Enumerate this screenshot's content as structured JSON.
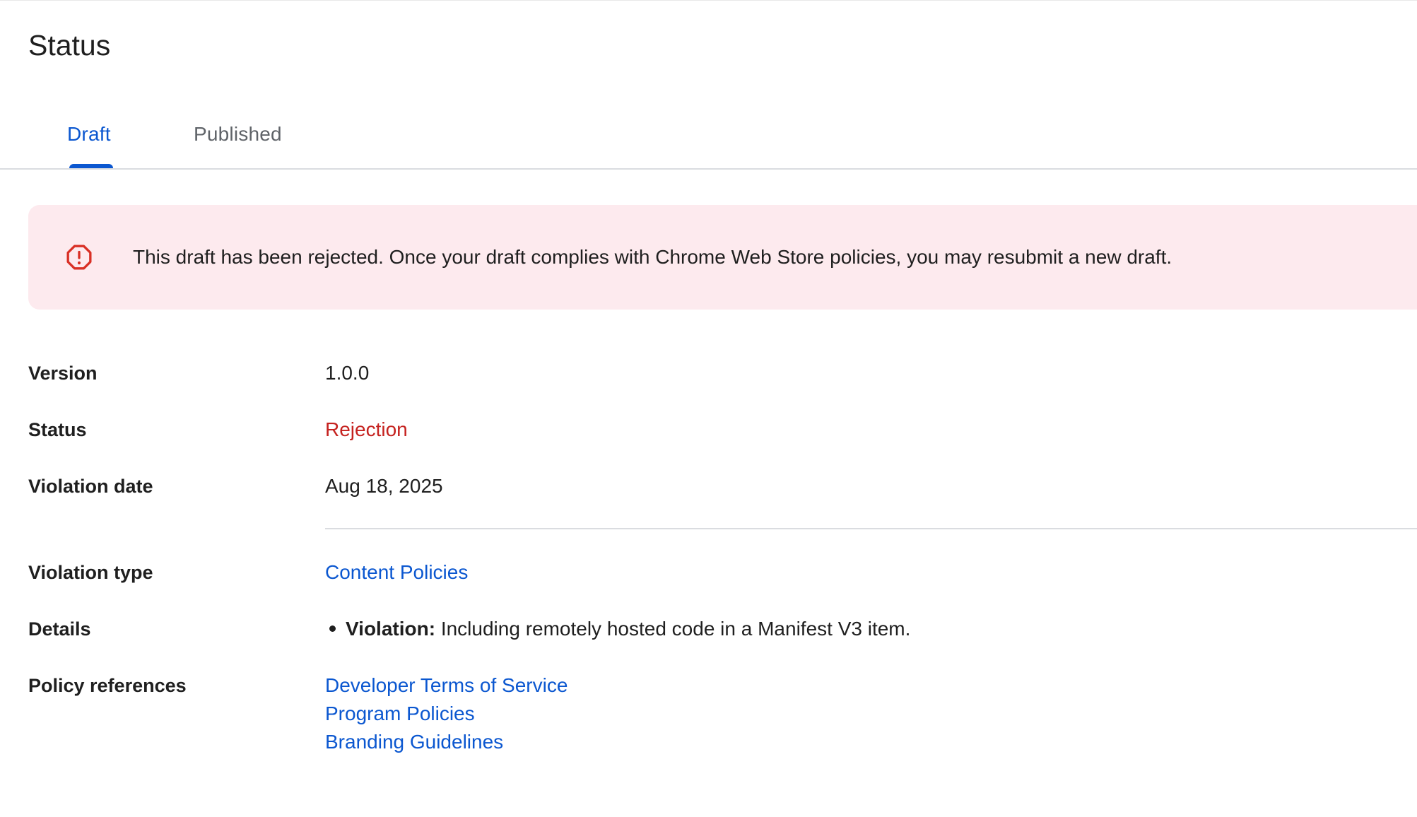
{
  "page": {
    "title": "Status"
  },
  "tabs": [
    {
      "label": "Draft",
      "active": true
    },
    {
      "label": "Published",
      "active": false
    }
  ],
  "alert": {
    "icon": "error-octagon-icon",
    "message": "This draft has been rejected. Once your draft complies with Chrome Web Store policies, you may resubmit a new draft.",
    "color": "#d93025",
    "background": "#fdeaee"
  },
  "details": {
    "version": {
      "label": "Version",
      "value": "1.0.0"
    },
    "status": {
      "label": "Status",
      "value": "Rejection",
      "color": "#c5221f"
    },
    "violation_date": {
      "label": "Violation date",
      "value": "Aug 18, 2025"
    },
    "violation_type": {
      "label": "Violation type",
      "value": "Content Policies"
    },
    "details": {
      "label": "Details",
      "items": [
        {
          "bold": "Violation:",
          "text": " Including remotely hosted code in a Manifest V3 item."
        }
      ]
    },
    "policy_references": {
      "label": "Policy references",
      "links": [
        "Developer Terms of Service",
        "Program Policies",
        "Branding Guidelines"
      ]
    }
  },
  "colors": {
    "accent": "#0b57d0",
    "text": "#1f1f1f",
    "muted": "#5f6368",
    "divider": "#dadce0"
  }
}
